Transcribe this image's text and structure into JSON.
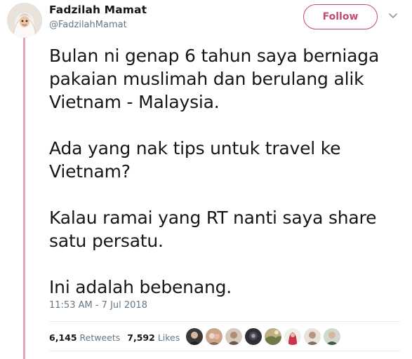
{
  "author": {
    "name": "Fadzilah Mamat",
    "handle": "@FadzilahMamat"
  },
  "follow_label": "Follow",
  "tweet": {
    "paragraphs": [
      "Bulan ni genap 6 tahun saya berniaga pakaian muslimah dan berulang alik Vietnam - Malaysia.",
      "Ada yang nak tips untuk travel ke Vietnam?",
      "Kalau ramai yang RT nanti saya share satu persatu.",
      "Ini adalah bebenang."
    ],
    "timestamp": "11:53 AM - 7 Jul 2018"
  },
  "stats": {
    "retweets_count": "6,145",
    "retweets_label": "Retweets",
    "likes_count": "7,592",
    "likes_label": "Likes"
  },
  "likers": [
    "liker-1",
    "liker-2",
    "liker-3",
    "liker-4",
    "liker-5",
    "liker-6",
    "liker-7",
    "liker-8"
  ],
  "colors": {
    "accent": "#c44a72",
    "thread_line": "#e6a4b4",
    "text": "#14171a",
    "muted": "#657786"
  }
}
